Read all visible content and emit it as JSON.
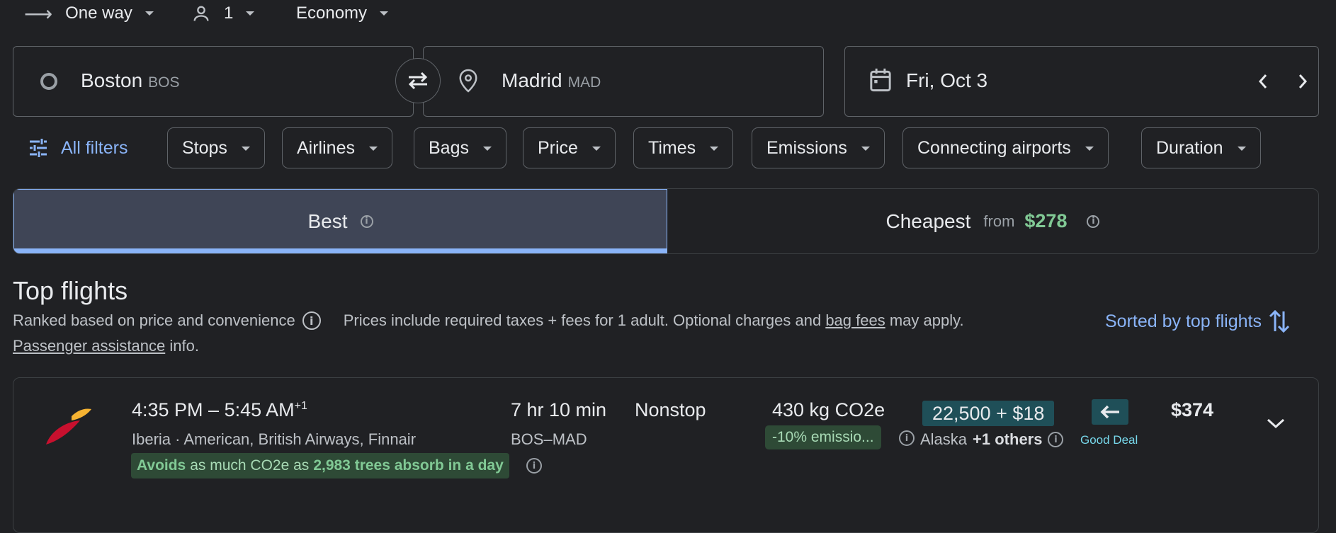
{
  "trip": {
    "type_label": "One way",
    "passengers": "1",
    "cabin": "Economy"
  },
  "search": {
    "origin_city": "Boston",
    "origin_code": "BOS",
    "dest_city": "Madrid",
    "dest_code": "MAD",
    "date": "Fri, Oct 3"
  },
  "filters": {
    "all": "All filters",
    "chips": [
      "Stops",
      "Airlines",
      "Bags",
      "Price",
      "Times",
      "Emissions",
      "Connecting airports",
      "Duration"
    ]
  },
  "tabs": {
    "best": "Best",
    "cheapest": "Cheapest",
    "from": "from",
    "cheapest_price": "$278"
  },
  "results": {
    "title": "Top flights",
    "ranked": "Ranked based on price and convenience",
    "prices_note_a": "Prices include required taxes + fees for 1 adult. Optional charges and",
    "bag_fees": "bag fees",
    "prices_note_b": "may apply.",
    "passenger_link": "Passenger assistance",
    "passenger_tail": "info.",
    "sort_label": "Sorted by top flights"
  },
  "flight": {
    "times": "4:35 PM – 5:45 AM",
    "plus_day": "+1",
    "airlines": "Iberia · American, British Airways, Finnair",
    "duration": "7 hr 10 min",
    "route": "BOS–MAD",
    "stops": "Nonstop",
    "emissions": "430 kg CO2e",
    "emissions_badge": "-10% emissio...",
    "points": "22,500 + $18",
    "program": "Alaska",
    "others": "+1 others",
    "deal": "Good Deal",
    "price": "$374",
    "avoid_a": "Avoids",
    "avoid_b": "as much CO2e as",
    "avoid_c": "2,983 trees absorb in a day"
  },
  "colors": {
    "bg": "#202124",
    "accent_blue": "#8ab4f8",
    "price_green": "#81c995",
    "points_teal": "#1f4f58"
  }
}
